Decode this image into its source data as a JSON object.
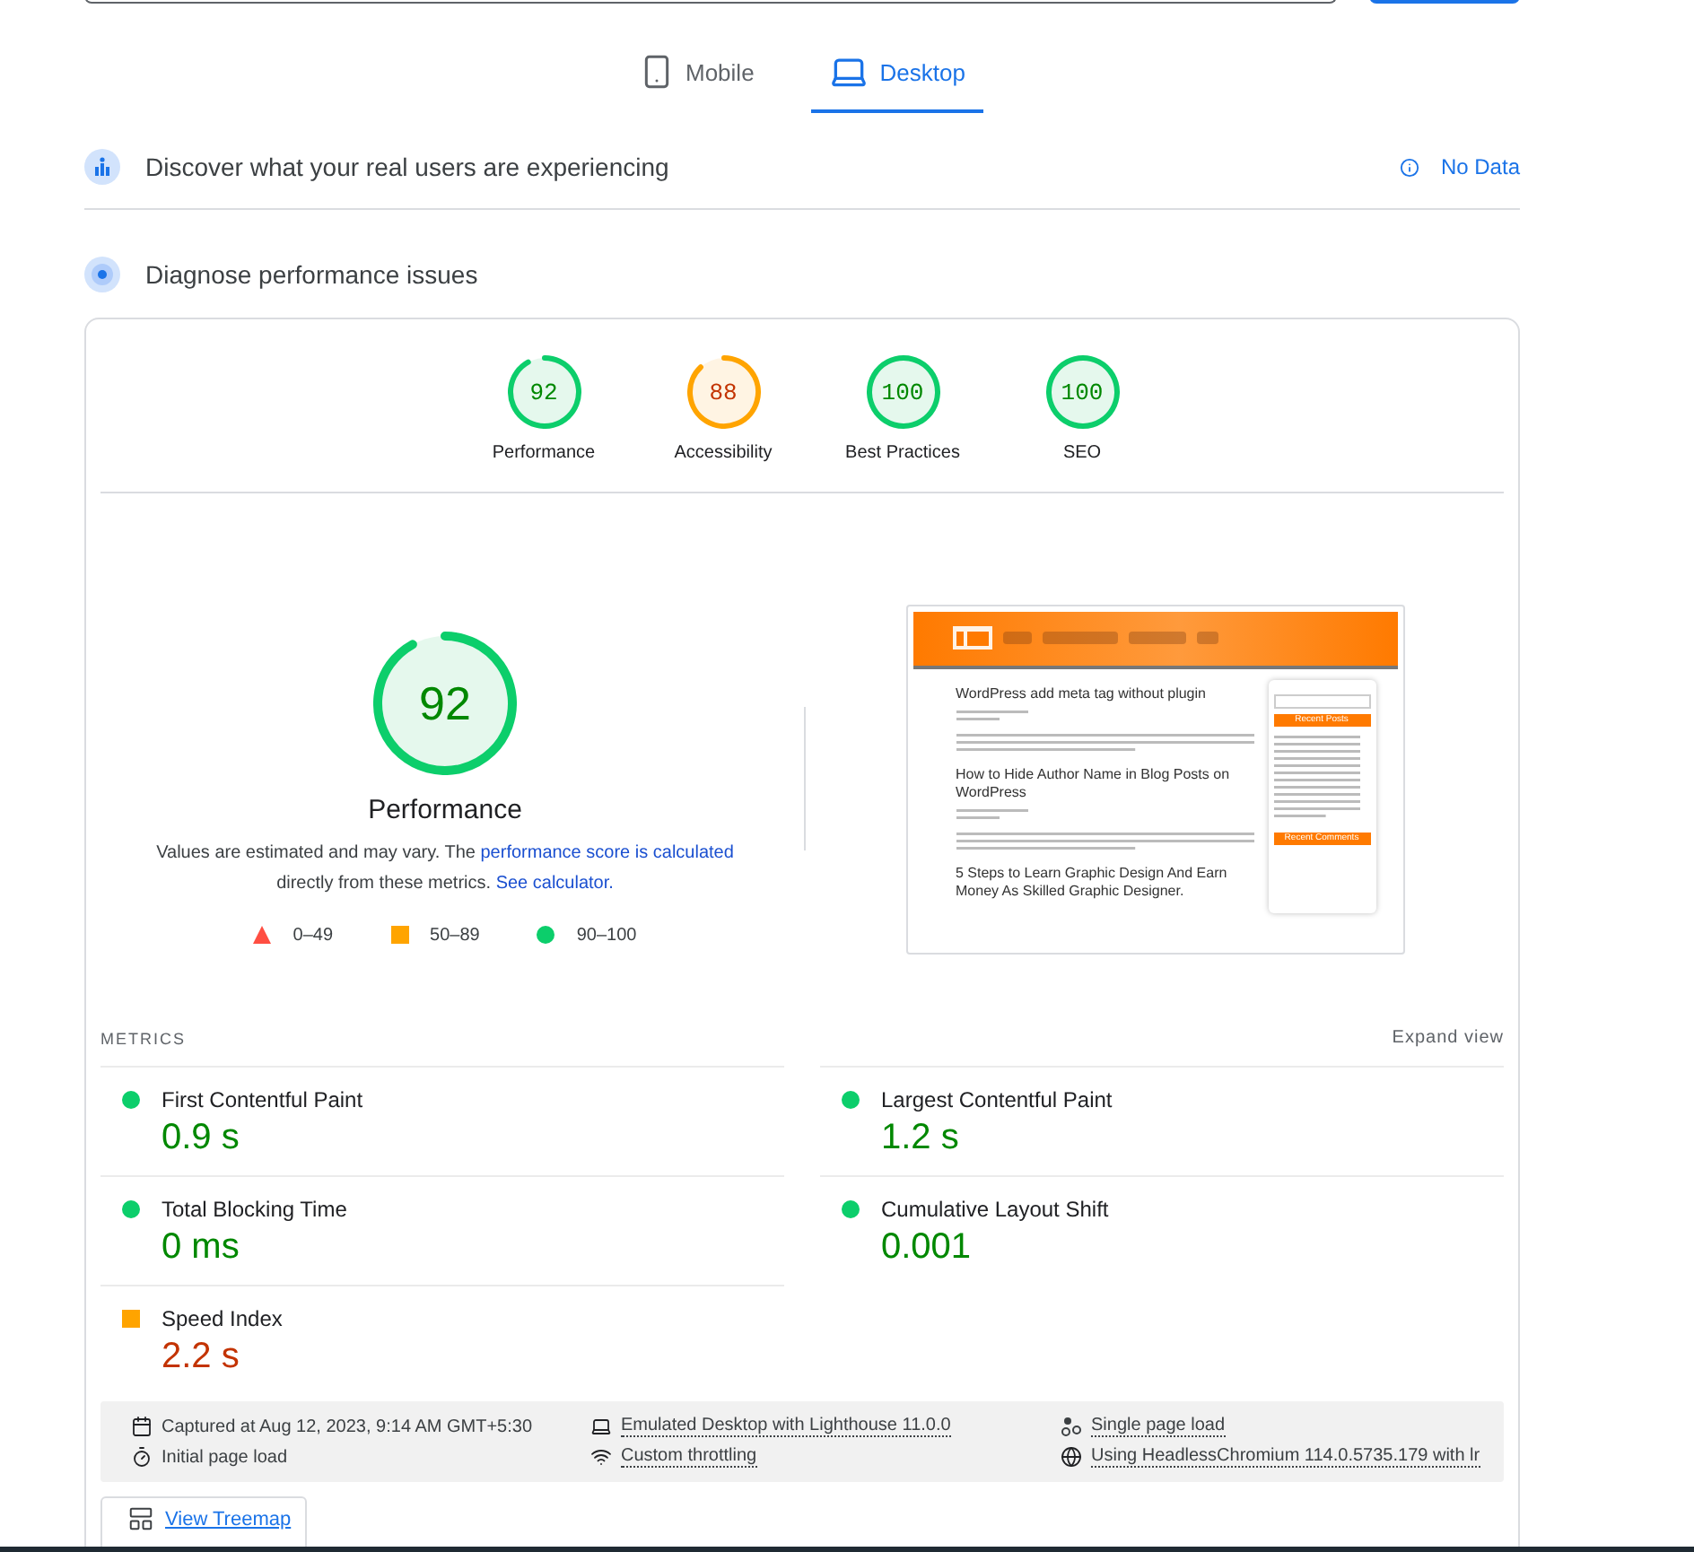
{
  "device_tabs": [
    {
      "label": "Mobile",
      "selected": false
    },
    {
      "label": "Desktop",
      "selected": true
    }
  ],
  "field_data": {
    "title": "Discover what your real users are experiencing",
    "status": "No Data"
  },
  "diagnose": {
    "title": "Diagnose performance issues"
  },
  "category_scores": [
    {
      "score": "92",
      "label": "Performance",
      "level": 0.92,
      "color": "#0cce6b"
    },
    {
      "score": "88",
      "label": "Accessibility",
      "level": 0.88,
      "color": "#ffa400"
    },
    {
      "score": "100",
      "label": "Best Practices",
      "level": 1,
      "color": "#0cce6b"
    },
    {
      "score": "100",
      "label": "SEO",
      "level": 1,
      "color": "#0cce6b"
    }
  ],
  "performance": {
    "score": "92",
    "level": 0.92,
    "color": "#0cce6b",
    "title": "Performance",
    "note_start": "Values are estimated and may vary. The ",
    "note_link": "performance score is calculated",
    "note_middle": " directly from these metrics. ",
    "calculator_link": "See calculator."
  },
  "legend": [
    {
      "color": "#ff4e42",
      "range": "0–49"
    },
    {
      "color": "#ffa400",
      "range": "50–89"
    },
    {
      "color": "#0cce6b",
      "range": "90–100"
    }
  ],
  "page_screenshot": {
    "posts": [
      "WordPress add meta tag without plugin",
      "How to Hide Author Name in Blog Posts on WordPress",
      "5 Steps to Learn Graphic Design And Earn Money As Skilled Graphic Designer."
    ],
    "sidebar_headings": [
      "Recent Posts",
      "Recent Comments"
    ]
  },
  "metrics": {
    "heading": "METRICS",
    "expand": "Expand view",
    "items": [
      {
        "name": "First Contentful Paint",
        "value": "0.9 s",
        "color": "#0cce6b"
      },
      {
        "name": "Largest Contentful Paint",
        "value": "1.2 s",
        "color": "#0cce6b"
      },
      {
        "name": "Total Blocking Time",
        "value": "0 ms",
        "color": "#0cce6b"
      },
      {
        "name": "Cumulative Layout Shift",
        "value": "0.001",
        "color": "#0cce6b"
      },
      {
        "name": "Speed Index",
        "value": "2.2 s",
        "color": "#ffa400"
      }
    ]
  },
  "runtime": [
    {
      "text": "Captured at Aug 12, 2023, 9:14 AM GMT+5:30",
      "tooltip": false
    },
    {
      "text": "Emulated Desktop with Lighthouse 11.0.0",
      "tooltip": true
    },
    {
      "text": "Single page load",
      "tooltip": true
    },
    {
      "text": "Initial page load",
      "tooltip": false
    },
    {
      "text": "Custom throttling",
      "tooltip": true
    },
    {
      "text": "Using HeadlessChromium 114.0.5735.179 with lr",
      "tooltip": true
    }
  ],
  "treemap_button": "View Treemap"
}
